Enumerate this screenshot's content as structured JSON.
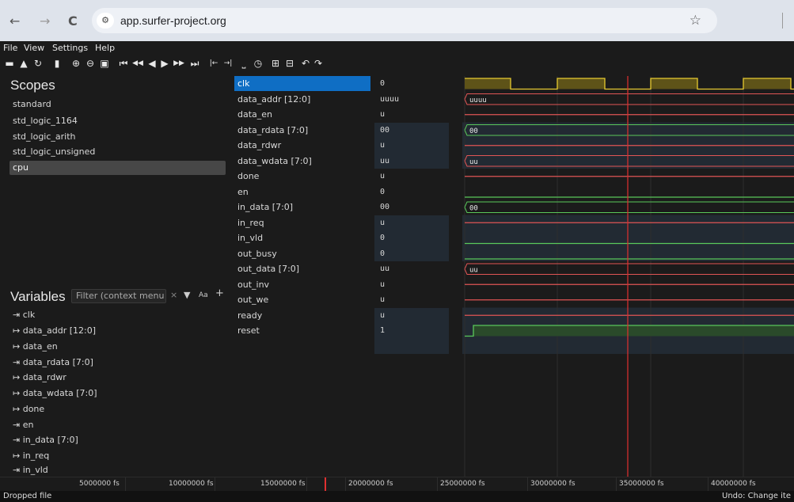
{
  "browser": {
    "back": "←",
    "forward": "→",
    "reload": "C",
    "site_icon": "⚙",
    "url": "app.surfer-project.org",
    "star": "☆"
  },
  "menu": [
    "File",
    "View",
    "Settings",
    "Help"
  ],
  "toolbar_icons": [
    {
      "name": "open-folder-icon",
      "glyph": "▬"
    },
    {
      "name": "download-icon",
      "glyph": "▲"
    },
    {
      "name": "refresh-icon",
      "glyph": "↻"
    },
    {
      "name": "copy-icon",
      "glyph": "▮"
    },
    {
      "name": "zoom-in-icon",
      "glyph": "⊕"
    },
    {
      "name": "zoom-out-icon",
      "glyph": "⊖"
    },
    {
      "name": "zoom-fit-icon",
      "glyph": "▣"
    },
    {
      "name": "goto-start-icon",
      "glyph": "⏮"
    },
    {
      "name": "step-back-fast-icon",
      "glyph": "◀◀"
    },
    {
      "name": "step-back-icon",
      "glyph": "◀"
    },
    {
      "name": "step-forward-icon",
      "glyph": "▶"
    },
    {
      "name": "step-forward-fast-icon",
      "glyph": "▶▶"
    },
    {
      "name": "goto-end-icon",
      "glyph": "⏭"
    },
    {
      "name": "prev-transition-icon",
      "glyph": "|←"
    },
    {
      "name": "next-transition-icon",
      "glyph": "→|"
    },
    {
      "name": "divider-icon",
      "glyph": "⎵"
    },
    {
      "name": "timer-icon",
      "glyph": "◷"
    },
    {
      "name": "add-icon",
      "glyph": "⊞"
    },
    {
      "name": "remove-icon",
      "glyph": "⊟"
    },
    {
      "name": "undo-icon",
      "glyph": "↶"
    },
    {
      "name": "redo-icon",
      "glyph": "↷"
    }
  ],
  "scopes": {
    "title": "Scopes",
    "items": [
      "standard",
      "std_logic_1164",
      "std_logic_arith",
      "std_logic_unsigned",
      "cpu"
    ],
    "selected": "cpu"
  },
  "variables": {
    "title": "Variables",
    "filter_placeholder": "Filter (context menu",
    "clear": "×",
    "filter_glyph": "▼",
    "case_glyph": "Aa",
    "add_glyph": "+",
    "items": [
      "⇥ clk",
      "↦ data_addr [12:0]",
      "↦ data_en",
      "⇥ data_rdata [7:0]",
      "↦ data_rdwr",
      "↦ data_wdata [7:0]",
      "↦ done",
      "⇥ en",
      "⇥ in_data [7:0]",
      "↦ in_req",
      "⇥ in_vld"
    ]
  },
  "signals": [
    {
      "name": "clk",
      "value": "0",
      "kind": "clock",
      "color": "#e6c930"
    },
    {
      "name": "data_addr [12:0]",
      "value": "uuuu",
      "kind": "bus",
      "color": "#e05555"
    },
    {
      "name": "data_en",
      "value": "u",
      "kind": "bit",
      "color": "#e05555"
    },
    {
      "name": "data_rdata [7:0]",
      "value": "00",
      "kind": "bus",
      "color": "#5ac85a"
    },
    {
      "name": "data_rdwr",
      "value": "u",
      "kind": "bit",
      "color": "#e05555"
    },
    {
      "name": "data_wdata [7:0]",
      "value": "uu",
      "kind": "bus",
      "color": "#e05555"
    },
    {
      "name": "done",
      "value": "u",
      "kind": "bit",
      "color": "#e05555"
    },
    {
      "name": "en",
      "value": "0",
      "kind": "bit",
      "color": "#5ac85a"
    },
    {
      "name": "in_data [7:0]",
      "value": "00",
      "kind": "bus",
      "color": "#5ac85a"
    },
    {
      "name": "in_req",
      "value": "u",
      "kind": "bit",
      "color": "#e05555"
    },
    {
      "name": "in_vld",
      "value": "0",
      "kind": "bit",
      "color": "#5ac85a"
    },
    {
      "name": "out_busy",
      "value": "0",
      "kind": "bit",
      "color": "#5ac85a"
    },
    {
      "name": "out_data [7:0]",
      "value": "uu",
      "kind": "bus",
      "color": "#e05555"
    },
    {
      "name": "out_inv",
      "value": "u",
      "kind": "bit",
      "color": "#e05555"
    },
    {
      "name": "out_we",
      "value": "u",
      "kind": "bit",
      "color": "#e05555"
    },
    {
      "name": "ready",
      "value": "u",
      "kind": "bit",
      "color": "#e05555"
    },
    {
      "name": "reset",
      "value": "1",
      "kind": "reset",
      "color": "#5ac85a"
    }
  ],
  "selected_signal": "clk",
  "timeline": {
    "ticks": [
      "5000000 fs",
      "10000000 fs",
      "15000000 fs",
      "20000000 fs",
      "25000000 fs",
      "30000000 fs",
      "35000000 fs",
      "40000000 fs"
    ],
    "cursor_time": "35000000 fs"
  },
  "status": {
    "left": "Dropped file",
    "right": "Undo: Change ite"
  },
  "colors": {
    "accent": "#0f6ec4",
    "cursor": "#e03030",
    "clock": "#e6c930",
    "valid": "#5ac85a",
    "undefined": "#e05555"
  }
}
